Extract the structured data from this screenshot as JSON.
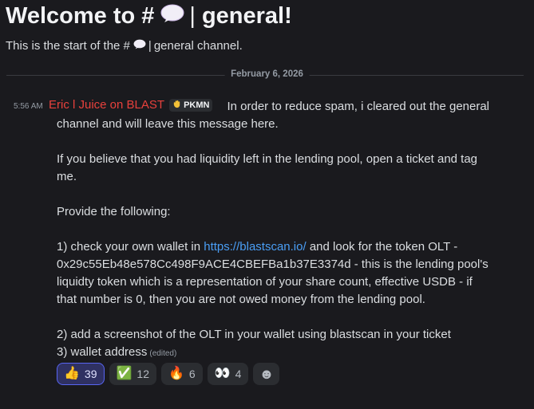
{
  "channel": {
    "welcome_prefix": "Welcome to #",
    "separator": "|",
    "welcome_suffix": "general!",
    "sub_prefix": "This is the start of the #",
    "sub_suffix": "general channel."
  },
  "date_divider": "February 6, 2026",
  "message": {
    "time": "5:56 AM",
    "author": "Eric l Juice on BLAST",
    "tag": "PKMN",
    "author_color": "#e8413c",
    "lines": {
      "l1": "In order to reduce spam, i cleared out the general",
      "l2": "channel and will leave this message here.",
      "l3": "If you believe that you had liquidity left in the lending pool, open a ticket and tag",
      "l4": "me.",
      "l5": "Provide the following:",
      "l6_pre": "1) check your own wallet in ",
      "l6_link": "https://blastscan.io/",
      "l6_post": " and look for the token OLT -",
      "l7": "0x29c55Eb48e578Cc498F9ACE4CBEFBa1b37E3374d - this is the lending pool's",
      "l8": "liquidty token which is a representation of your share count, effective USDB - if",
      "l9": "that number is 0, then you are not owed money from the lending pool.",
      "l10": "2) add a screenshot of the OLT in your wallet using blastscan in your ticket",
      "l11": "3) wallet address",
      "edited": "(edited)"
    }
  },
  "reactions": [
    {
      "emoji": "👍",
      "icon": "thumbs-up-icon",
      "count": "39"
    },
    {
      "emoji": "✅",
      "icon": "check-mark-icon",
      "count": "12"
    },
    {
      "emoji": "🔥",
      "icon": "fire-icon",
      "count": "6"
    },
    {
      "emoji": "👀",
      "icon": "eyes-icon",
      "count": "4"
    },
    {
      "emoji": "☻",
      "icon": "smiley-icon"
    }
  ]
}
